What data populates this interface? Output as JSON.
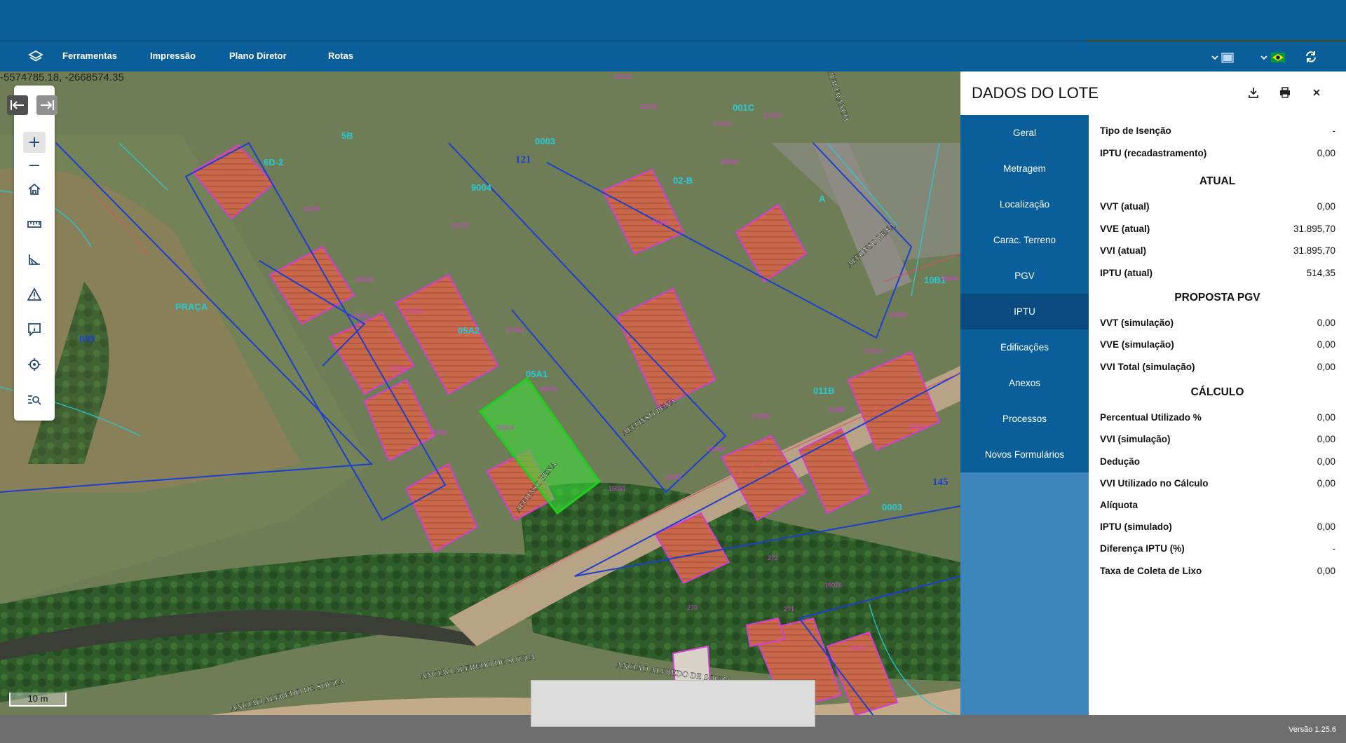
{
  "nav": {
    "items": [
      {
        "label": "Ferramentas"
      },
      {
        "label": "Impressão"
      },
      {
        "label": "Plano Diretor"
      },
      {
        "label": "Rotas"
      }
    ]
  },
  "map": {
    "coordinates": "-5574785.18, -2668574.35",
    "scale_label": "10 m",
    "labels": [
      {
        "text": "6D-2",
        "color": "#27c9d6"
      },
      {
        "text": "5B",
        "color": "#27c9d6"
      },
      {
        "text": "0003",
        "color": "#27c9d6"
      },
      {
        "text": "121",
        "color": "#1b3fcf"
      },
      {
        "text": "9004",
        "color": "#27c9d6"
      },
      {
        "text": "PRAÇA",
        "color": "#27c9d6"
      },
      {
        "text": "009",
        "color": "#1b3fcf"
      },
      {
        "text": "05A2",
        "color": "#27c9d6"
      },
      {
        "text": "05A1",
        "color": "#27c9d6"
      },
      {
        "text": "02-B",
        "color": "#27c9d6"
      },
      {
        "text": "001C",
        "color": "#27c9d6"
      },
      {
        "text": "A",
        "color": "#27c9d6"
      },
      {
        "text": "011B",
        "color": "#27c9d6"
      },
      {
        "text": "10B1",
        "color": "#27c9d6"
      },
      {
        "text": "145",
        "color": "#1b3fcf"
      },
      {
        "text": "0003",
        "color": "#27c9d6"
      },
      {
        "text": "15105",
        "color": "#d63cd6"
      },
      {
        "text": "36492",
        "color": "#d63cd6"
      },
      {
        "text": "15101",
        "color": "#d63cd6"
      },
      {
        "text": "15102",
        "color": "#d63cd6"
      },
      {
        "text": "27690",
        "color": "#d63cd6"
      },
      {
        "text": "27676",
        "color": "#d63cd6"
      },
      {
        "text": "27670",
        "color": "#d63cd6"
      },
      {
        "text": "36530",
        "color": "#d63cd6"
      },
      {
        "text": "27683",
        "color": "#d63cd6"
      },
      {
        "text": "36501",
        "color": "#d63cd6"
      },
      {
        "text": "36504",
        "color": "#d63cd6"
      },
      {
        "text": "27692",
        "color": "#d63cd6"
      },
      {
        "text": "27686",
        "color": "#d63cd6"
      },
      {
        "text": "27688",
        "color": "#d63cd6"
      },
      {
        "text": "36526",
        "color": "#d63cd6"
      },
      {
        "text": "36524",
        "color": "#d63cd6"
      },
      {
        "text": "15109",
        "color": "#d63cd6"
      },
      {
        "text": "15086",
        "color": "#d63cd6"
      },
      {
        "text": "15085",
        "color": "#d63cd6"
      },
      {
        "text": "15088",
        "color": "#d63cd6"
      },
      {
        "text": "15087",
        "color": "#d63cd6"
      },
      {
        "text": "15091",
        "color": "#d63cd6"
      },
      {
        "text": "15082",
        "color": "#d63cd6"
      },
      {
        "text": "27615",
        "color": "#d63cd6"
      },
      {
        "text": "36465",
        "color": "#d63cd6"
      },
      {
        "text": "36461",
        "color": "#d63cd6"
      },
      {
        "text": "272",
        "color": "#d63cd6"
      },
      {
        "text": "271",
        "color": "#d63cd6"
      },
      {
        "text": "270",
        "color": "#d63cd6"
      },
      {
        "text": "15076",
        "color": "#d63cd6"
      },
      {
        "text": "15077",
        "color": "#d63cd6"
      }
    ],
    "streets": [
      {
        "text": "AFFONSO PENA"
      },
      {
        "text": "AFFONSO PENA"
      },
      {
        "text": "AFFONSO PENA"
      },
      {
        "text": "ANCIÃO ALFREDO DE SOUZA"
      },
      {
        "text": "ANCIÃO ALFREDO DE SOUZA"
      },
      {
        "text": "ANCIÃO ALFREDO DE SOUZA"
      },
      {
        "text": "HUR FRANCO"
      }
    ]
  },
  "panel": {
    "title": "DADOS DO LOTE",
    "tabs": [
      {
        "label": "Geral"
      },
      {
        "label": "Metragem"
      },
      {
        "label": "Localização"
      },
      {
        "label": "Carac. Terreno"
      },
      {
        "label": "PGV"
      },
      {
        "label": "IPTU"
      },
      {
        "label": "Edificações"
      },
      {
        "label": "Anexos"
      },
      {
        "label": "Processos"
      },
      {
        "label": "Novos Formulários"
      }
    ],
    "active_tab": "IPTU",
    "top_rows": [
      {
        "label": "Tipo de Isenção",
        "value": "-"
      },
      {
        "label": "IPTU (recadastramento)",
        "value": "0,00"
      }
    ],
    "atual": {
      "heading": "ATUAL",
      "rows": [
        {
          "label": "VVT (atual)",
          "value": "0,00"
        },
        {
          "label": "VVE (atual)",
          "value": "31.895,70"
        },
        {
          "label": "VVI (atual)",
          "value": "31.895,70"
        },
        {
          "label": "IPTU (atual)",
          "value": "514,35"
        }
      ]
    },
    "proposta": {
      "heading": "PROPOSTA PGV",
      "rows": [
        {
          "label": "VVT (simulação)",
          "value": "0,00"
        },
        {
          "label": "VVE (simulação)",
          "value": "0,00"
        },
        {
          "label": "VVI Total (simulação)",
          "value": "0,00"
        }
      ]
    },
    "calculo": {
      "heading": "CÁLCULO",
      "rows": [
        {
          "label": "Percentual Utilizado %",
          "value": "0,00"
        },
        {
          "label": "VVI (simulação)",
          "value": "0,00"
        },
        {
          "label": "Dedução",
          "value": "0,00"
        },
        {
          "label": "VVI Utilizado no Cálculo",
          "value": "0,00"
        },
        {
          "label": "Alíquota",
          "value": ""
        },
        {
          "label": "IPTU (simulado)",
          "value": "0,00"
        },
        {
          "label": "Diferença IPTU (%)",
          "value": "-"
        },
        {
          "label": "Taxa de Coleta de Lixo",
          "value": "0,00"
        }
      ]
    }
  },
  "footer": {
    "version": "Versão 1.25.6"
  },
  "colors": {
    "header": "#0a5f9a",
    "tab_active": "#0a4a7e",
    "lot_outline": "#1b3fcf",
    "building_outline": "#d63cd6",
    "selected_lot": "#39e639"
  }
}
